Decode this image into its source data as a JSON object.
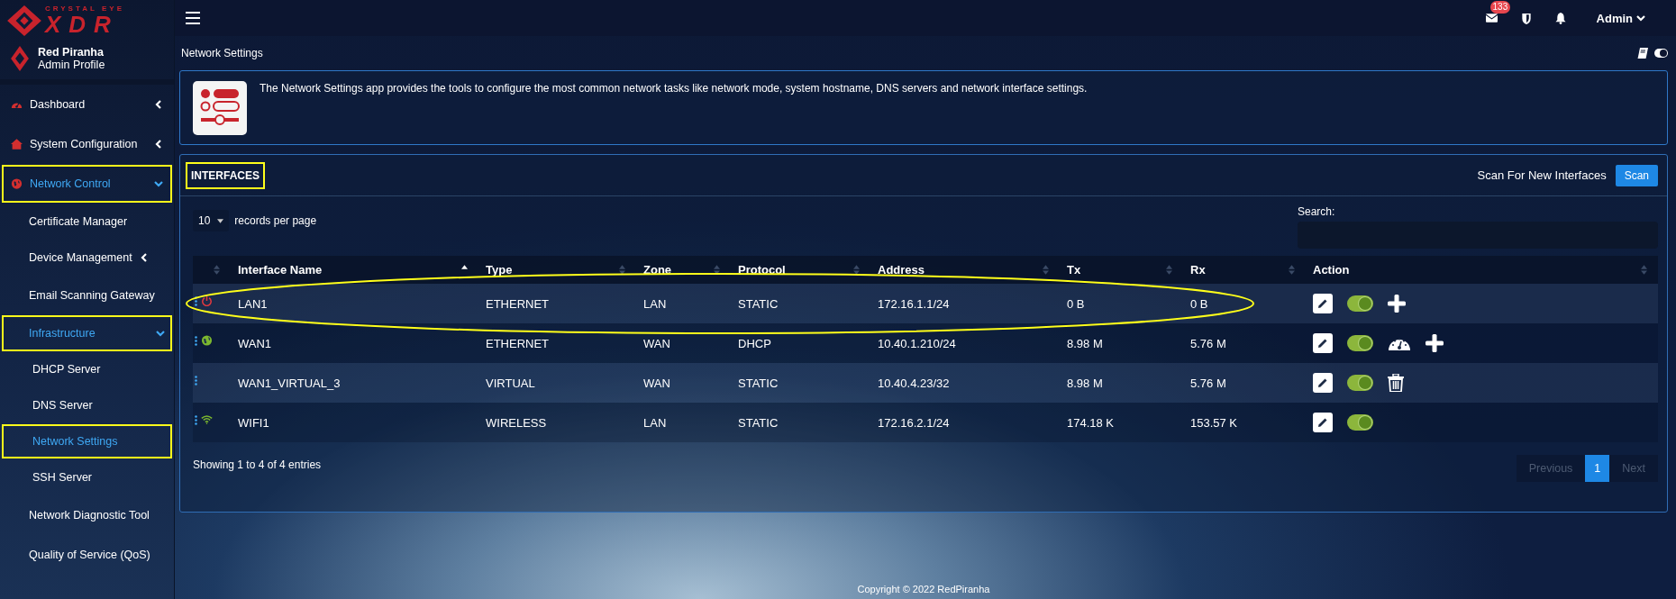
{
  "brand": {
    "tagline": "CRYSTAL EYE",
    "name": "XDR"
  },
  "profile": {
    "name": "Red Piranha",
    "role": "Admin Profile"
  },
  "topbar": {
    "mail_badge": "133",
    "user": "Admin"
  },
  "sidebar": {
    "items": [
      {
        "label": "Dashboard",
        "expanded": false,
        "selected": false,
        "highlighted": false
      },
      {
        "label": "System Configuration",
        "expanded": false,
        "selected": false,
        "highlighted": false
      },
      {
        "label": "Network Control",
        "expanded": true,
        "selected": true,
        "highlighted": true,
        "children": [
          {
            "label": "Certificate Manager",
            "selected": false,
            "highlighted": false
          },
          {
            "label": "Device Management",
            "expanded": false,
            "selected": false,
            "highlighted": false
          },
          {
            "label": "Email Scanning Gateway",
            "selected": false,
            "highlighted": false
          },
          {
            "label": "Infrastructure",
            "expanded": true,
            "selected": true,
            "highlighted": true,
            "children": [
              {
                "label": "DHCP Server",
                "selected": false,
                "highlighted": false
              },
              {
                "label": "DNS Server",
                "selected": false,
                "highlighted": false
              },
              {
                "label": "Network Settings",
                "selected": true,
                "highlighted": true
              },
              {
                "label": "SSH Server",
                "selected": false,
                "highlighted": false
              }
            ]
          },
          {
            "label": "Network Diagnostic Tool",
            "selected": false,
            "highlighted": false
          },
          {
            "label": "Quality of Service (QoS)",
            "selected": false,
            "highlighted": false
          }
        ]
      }
    ]
  },
  "breadcrumb": "Network Settings",
  "theme_toggle": {
    "on": true
  },
  "info": "The Network Settings app provides the tools to configure the most common network tasks like network mode, system hostname, DNS servers and network interface settings.",
  "interfaces": {
    "title": "INTERFACES",
    "title_highlighted": true,
    "scan_label": "Scan For New Interfaces",
    "scan_button": "Scan",
    "page_length": "10",
    "page_length_label": "records per page",
    "search_label": "Search:",
    "columns": [
      {
        "sorted": false
      },
      {
        "label": "Interface Name",
        "sorted": true
      },
      {
        "label": "Type",
        "sorted": false
      },
      {
        "label": "Zone",
        "sorted": false
      },
      {
        "label": "Protocol",
        "sorted": false
      },
      {
        "label": "Address",
        "sorted": false
      },
      {
        "label": "Tx",
        "sorted": false
      },
      {
        "label": "Rx",
        "sorted": false
      },
      {
        "label": "Action",
        "sorted": false
      }
    ],
    "rows": [
      {
        "name": "LAN1",
        "type": "ETHERNET",
        "zone": "LAN",
        "protocol": "STATIC",
        "address": "172.16.1.1/24",
        "tx": "0 B",
        "rx": "0 B",
        "kind": "down",
        "circled": true,
        "actions": [
          {
            "kind": "edit"
          },
          {
            "kind": "toggle",
            "on": true
          },
          {
            "kind": "add"
          }
        ]
      },
      {
        "name": "WAN1",
        "type": "ETHERNET",
        "zone": "WAN",
        "protocol": "DHCP",
        "address": "10.40.1.210/24",
        "tx": "8.98 M",
        "rx": "5.76 M",
        "kind": "wan",
        "circled": false,
        "actions": [
          {
            "kind": "edit"
          },
          {
            "kind": "toggle",
            "on": true
          },
          {
            "kind": "gauge"
          },
          {
            "kind": "add"
          }
        ]
      },
      {
        "name": "WAN1_VIRTUAL_3",
        "type": "VIRTUAL",
        "zone": "WAN",
        "protocol": "STATIC",
        "address": "10.40.4.23/32",
        "tx": "8.98 M",
        "rx": "5.76 M",
        "circled": false,
        "actions": [
          {
            "kind": "edit"
          },
          {
            "kind": "toggle",
            "on": true
          },
          {
            "kind": "delete"
          }
        ]
      },
      {
        "name": "WIFI1",
        "type": "WIRELESS",
        "zone": "LAN",
        "protocol": "STATIC",
        "address": "172.16.2.1/24",
        "tx": "174.18 K",
        "rx": "153.57 K",
        "kind": "wireless",
        "circled": false,
        "actions": [
          {
            "kind": "edit"
          },
          {
            "kind": "toggle",
            "on": true
          }
        ]
      }
    ],
    "summary": "Showing 1 to 4 of 4 entries",
    "pagination": {
      "previous": {
        "label": "Previous",
        "disabled": true
      },
      "pages": [
        {
          "label": "1",
          "selected": true
        }
      ],
      "next": {
        "label": "Next",
        "disabled": true
      }
    }
  },
  "footer": "Copyright © 2022 RedPiranha"
}
